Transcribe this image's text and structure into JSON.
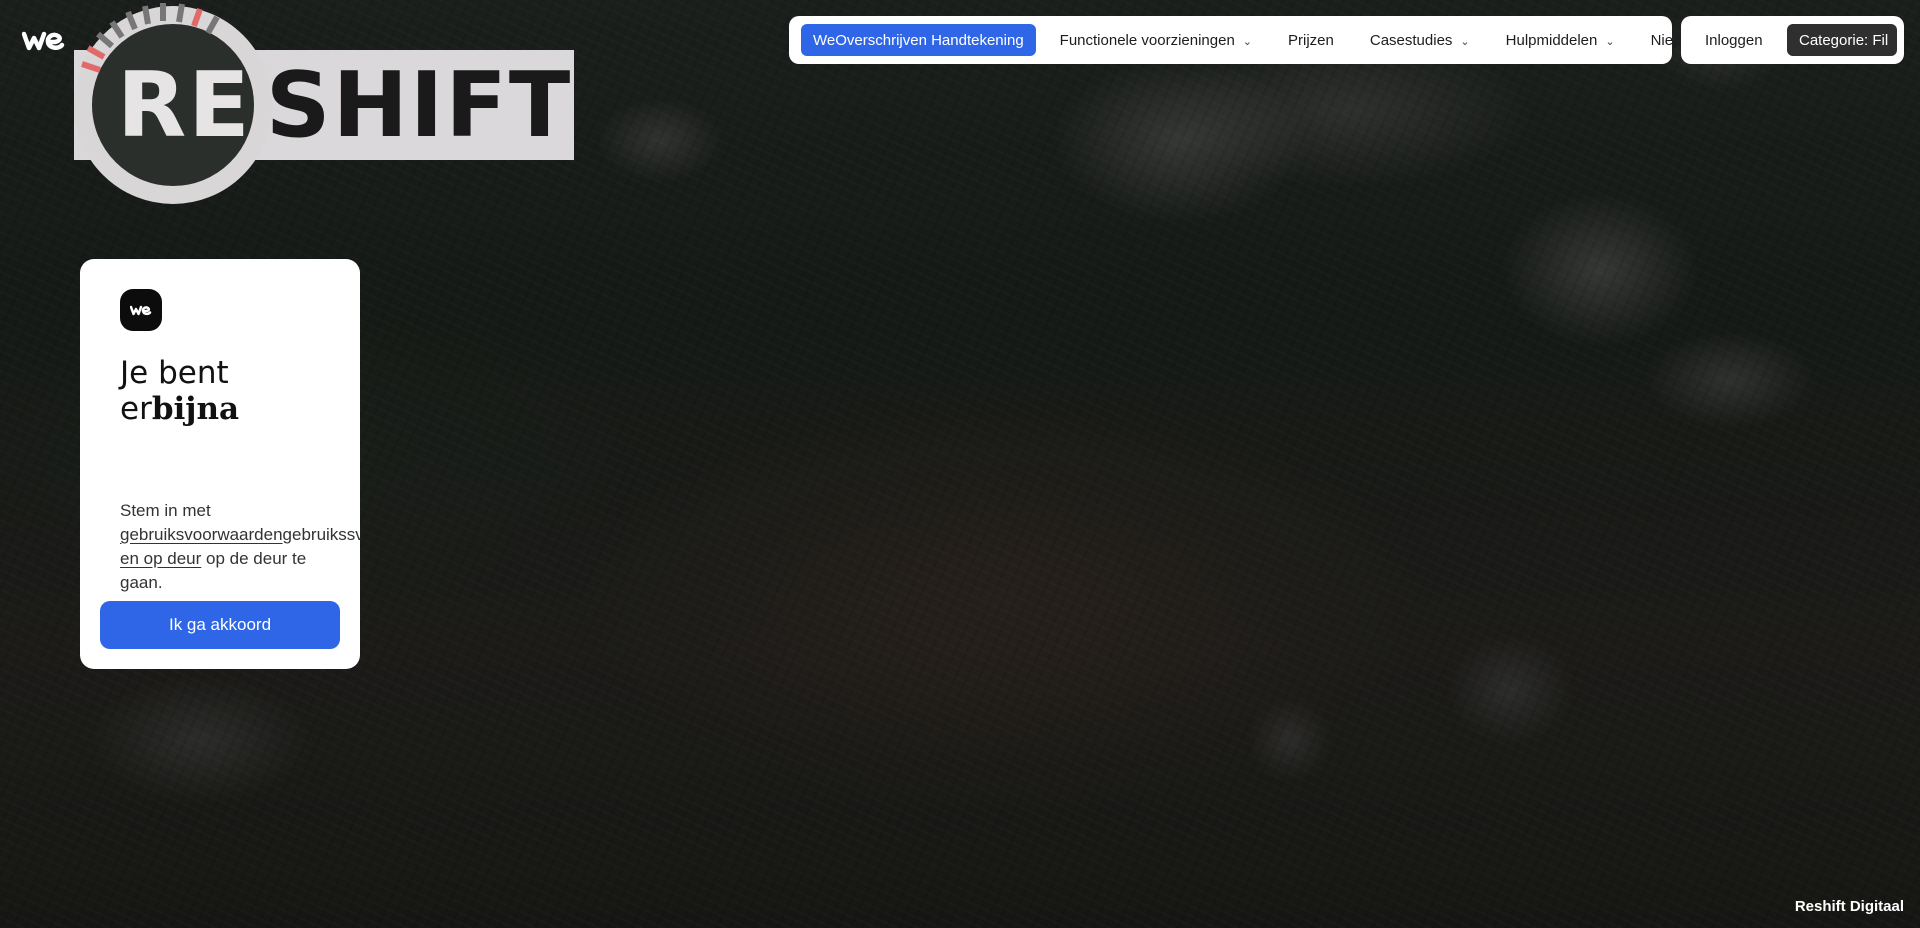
{
  "logo": {
    "mark_text": "we",
    "wordmark_re": "RE",
    "wordmark_shift": "SHIFT"
  },
  "nav": {
    "primary_label": "WeOverschrijven Handtekening",
    "items": [
      {
        "label": "Functionele voorzieningen",
        "dropdown": true
      },
      {
        "label": "Prijzen",
        "dropdown": false
      },
      {
        "label": "Casestudies",
        "dropdown": true
      },
      {
        "label": "Hulpmiddelen",
        "dropdown": true
      },
      {
        "label": "Nieuws",
        "dropdown": false
      }
    ],
    "login_label": "Inloggen",
    "category_label": "Categorie: Fil"
  },
  "card": {
    "title_line1": "Je bent",
    "title_line2_regular": "er",
    "title_line2_bold": "bijna",
    "body_intro": "Stem in met",
    "body_link1": "gebruiksvoorwaarden",
    "body_overflow": "gebruikssv",
    "body_link2": "en op deur",
    "body_after": " op de deur te",
    "body_end": "gaan.",
    "button_label": "Ik ga akkoord"
  },
  "footer": {
    "brand": "Reshift Digitaal"
  },
  "colors": {
    "accent": "#2f66e8",
    "dark": "#2f2f2f",
    "tick_red": "#e06a6a",
    "tick_grey": "#777777"
  }
}
